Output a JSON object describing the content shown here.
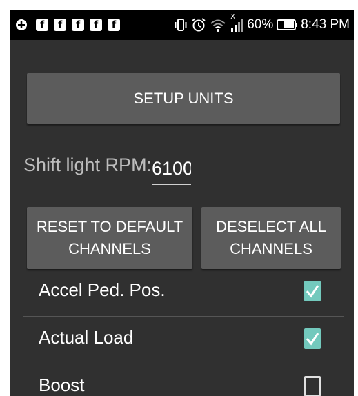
{
  "status_bar": {
    "facebook_icons": [
      "f",
      "f",
      "f",
      "f",
      "f"
    ],
    "battery_percent": "60%",
    "time": "8:43 PM",
    "signal_mark": "X"
  },
  "buttons": {
    "setup_units": "SETUP UNITS",
    "reset_default": "RESET TO DEFAULT\nCHANNELS",
    "deselect_all": "DESELECT ALL\nCHANNELS"
  },
  "shift_light": {
    "label": "Shift light RPM:",
    "value": "6100"
  },
  "channels": [
    {
      "label": "Accel Ped. Pos.",
      "checked": true
    },
    {
      "label": "Actual Load",
      "checked": true
    },
    {
      "label": "Boost",
      "checked": false
    }
  ],
  "colors": {
    "checkbox_checked": "#73c9bd",
    "background": "#303030",
    "button": "#5c5c5c"
  }
}
